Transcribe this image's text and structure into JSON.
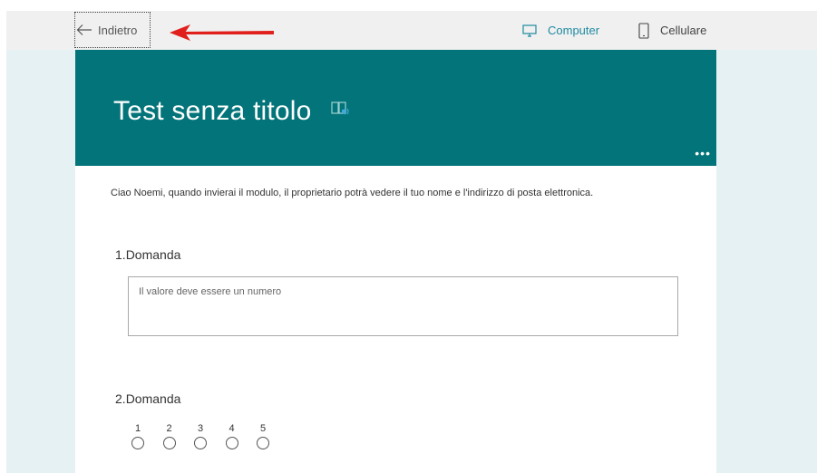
{
  "topbar": {
    "back_label": "Indietro",
    "views": [
      {
        "label": "Computer",
        "icon": "monitor-icon",
        "active": true
      },
      {
        "label": "Cellulare",
        "icon": "phone-icon",
        "active": false
      }
    ]
  },
  "form": {
    "title": "Test senza titolo",
    "notice": "Ciao Noemi, quando invierai il modulo, il proprietario potrà vedere il tuo nome e l'indirizzo di posta elettronica.",
    "questions": [
      {
        "number": "1.",
        "title": "Domanda",
        "placeholder": "Il valore deve essere un numero"
      },
      {
        "number": "2.",
        "title": "Domanda",
        "scale": [
          "1",
          "2",
          "3",
          "4",
          "5"
        ]
      }
    ]
  },
  "colors": {
    "header": "#037479",
    "accent": "#1f8aa0",
    "page_background": "#e5f1f3",
    "annotation_arrow": "#e0201c"
  }
}
